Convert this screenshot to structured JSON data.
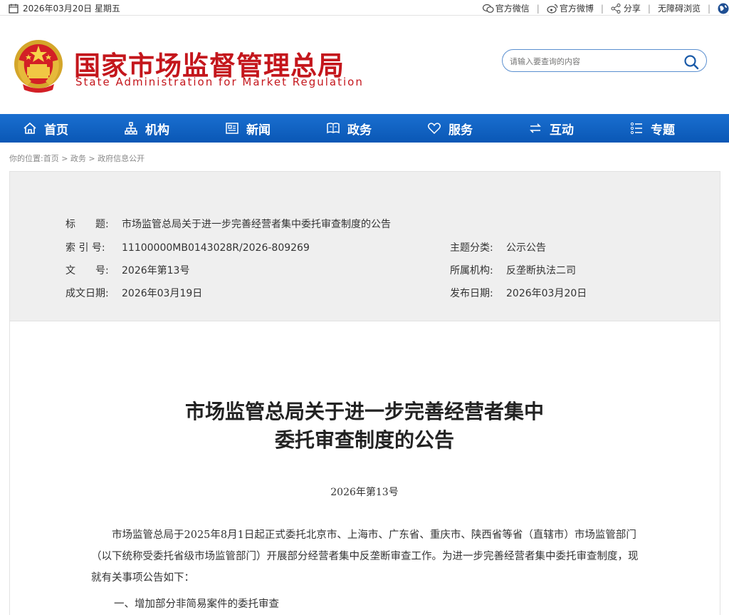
{
  "topbar": {
    "date": "2026年03月20日 星期五",
    "links": [
      {
        "label": "官方微信",
        "icon": "wechat-icon"
      },
      {
        "label": "官方微博",
        "icon": "weibo-icon"
      },
      {
        "label": "分享",
        "icon": "share-icon"
      },
      {
        "label": "无障碍浏览",
        "icon": ""
      }
    ]
  },
  "header": {
    "title_cn": "国家市场监督管理总局",
    "title_en": "State Administration for Market Regulation",
    "search_placeholder": "请输入要查询的内容",
    "brand_color": "#c4161c"
  },
  "nav": {
    "items": [
      {
        "label": "首页",
        "icon": "home-icon"
      },
      {
        "label": "机构",
        "icon": "org-icon"
      },
      {
        "label": "新闻",
        "icon": "news-icon"
      },
      {
        "label": "政务",
        "icon": "gov-icon"
      },
      {
        "label": "服务",
        "icon": "heart-icon"
      },
      {
        "label": "互动",
        "icon": "exchange-icon"
      },
      {
        "label": "专题",
        "icon": "list-icon"
      }
    ],
    "color": "#0a57b5"
  },
  "breadcrumb": "你的位置:首页 > 政务 > 政府信息公开",
  "meta": {
    "title_label": "标　　题:",
    "title_value": "市场监管总局关于进一步完善经营者集中委托审查制度的公告",
    "index_label": "索 引 号:",
    "index_value": "11100000MB0143028R/2026-809269",
    "doc_label": "文　　号:",
    "doc_value": "2026年第13号",
    "created_label": "成文日期:",
    "created_value": "2026年03月19日",
    "topic_label": "主题分类:",
    "topic_value": "公示公告",
    "org_label": "所属机构:",
    "org_value": "反垄断执法二司",
    "publish_label": "发布日期:",
    "publish_value": "2026年03月20日"
  },
  "article": {
    "title_line1": "市场监管总局关于进一步完善经营者集中",
    "title_line2": "委托审查制度的公告",
    "number": "2026年第13号",
    "paragraph": "市场监管总局于2025年8月1日起正式委托北京市、上海市、广东省、重庆市、陕西省等省（直辖市）市场监管部门（以下统称受委托省级市场监管部门）开展部分经营者集中反垄断审查工作。为进一步完善经营者集中委托审查制度，现就有关事项公告如下：",
    "sub_heading": "一、增加部分非简易案件的委托审查"
  }
}
